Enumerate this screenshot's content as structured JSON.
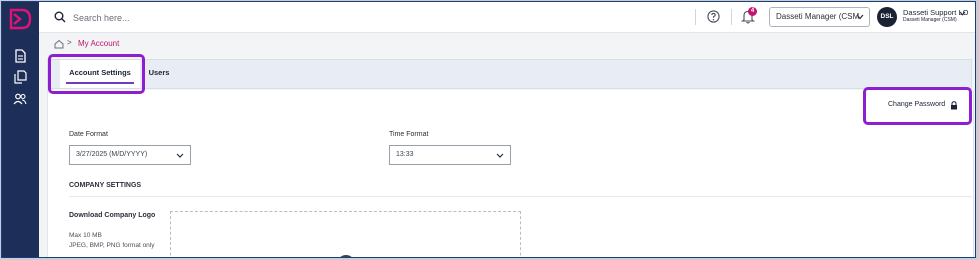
{
  "topbar": {
    "search_placeholder": "Search here...",
    "notification_count": "4",
    "role_select_value": "Dasseti Manager (CSM",
    "user": {
      "initials": "DSL",
      "name": "Dasseti Support LO",
      "role": "Dasseti Manager (CSM)"
    }
  },
  "breadcrumb": {
    "separator": ">",
    "current": "My Account"
  },
  "tabs": [
    {
      "label": "Account Settings",
      "active": true
    },
    {
      "label": "Users",
      "active": false
    }
  ],
  "actions": {
    "change_password": "Change Password"
  },
  "form": {
    "date_format": {
      "label": "Date Format",
      "value": "3/27/2025 (M/D/YYYY)"
    },
    "time_format": {
      "label": "Time Format",
      "value": "13:33"
    }
  },
  "company_settings": {
    "heading": "COMPANY SETTINGS",
    "logo": {
      "label": "Download Company Logo",
      "max_size": "Max 10 MB",
      "formats": "JPEG, BMP, PNG format only"
    }
  },
  "colors": {
    "rail": "#1d2e59",
    "accent": "#c0146f",
    "highlight": "#8e1fd1",
    "tab_underline": "#6d3bc0"
  },
  "icons": [
    "app-logo-icon",
    "document-icon",
    "documents-icon",
    "users-icon",
    "search-icon",
    "help-icon",
    "bell-icon",
    "chevron-down-icon",
    "home-icon",
    "lock-icon",
    "upload-icon"
  ]
}
